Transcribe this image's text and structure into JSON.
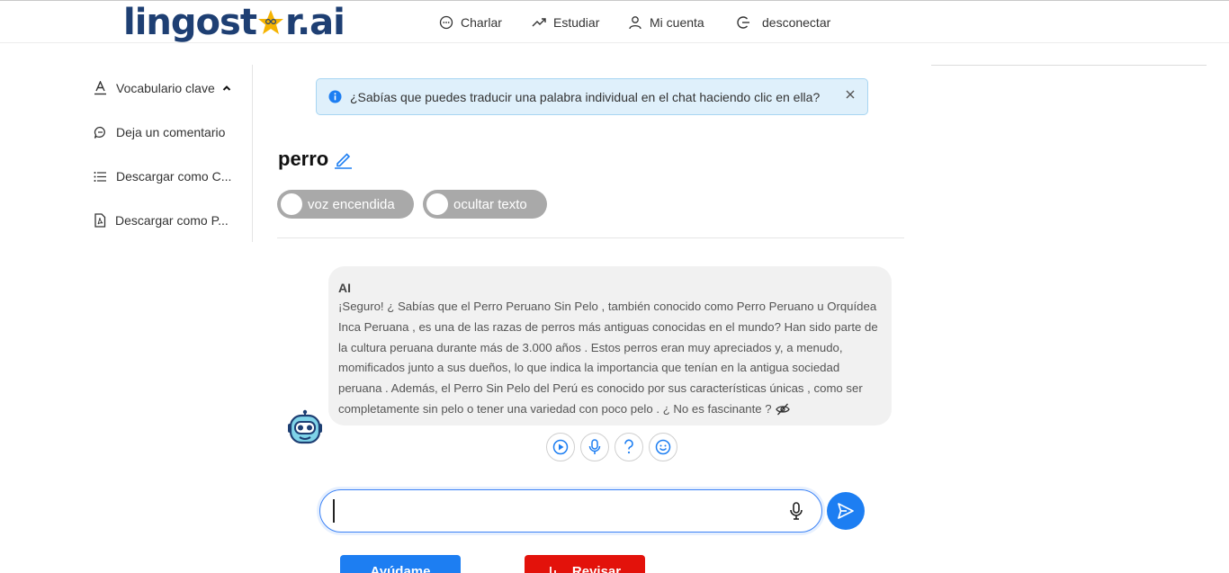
{
  "brand": {
    "logo_prefix": "lingost",
    "logo_suffix": "r.ai",
    "primary_color": "#1e3f73",
    "accent_color": "#f5b301"
  },
  "nav": {
    "chat": "Charlar",
    "study": "Estudiar",
    "account": "Mi cuenta",
    "logout": "desconectar"
  },
  "sidebar": {
    "items": [
      {
        "label": "Vocabulario clave",
        "icon": "font-underline-icon"
      },
      {
        "label": "Deja un comentario",
        "icon": "comment-icon"
      },
      {
        "label": "Descargar como C...",
        "icon": "list-icon"
      },
      {
        "label": "Descargar como P...",
        "icon": "pdf-file-icon"
      }
    ]
  },
  "tip": {
    "text": "¿Sabías que puedes traducir una palabra individual en el chat haciendo clic en ella?"
  },
  "topic": {
    "title": "perro"
  },
  "toggles": {
    "voice": "voz encendida",
    "hide_text": "ocultar texto"
  },
  "chat": {
    "sender": "AI",
    "message": "¡Seguro! ¿ Sabías que el Perro Peruano Sin Pelo , también conocido como Perro Peruano u Orquídea Inca Peruana , es una de las razas de perros más antiguas conocidas en el mundo? Han sido parte de la cultura peruana durante más de 3.000 años . Estos perros eran muy apreciados y, a menudo, momificados junto a sus dueños, lo que indica la importancia que tenían en la antigua sociedad peruana . Además, el Perro Sin Pelo del Perú es conocido por sus características únicas , como ser completamente sin pelo o tener una variedad con poco pelo . ¿ No es fascinante ?"
  },
  "composer": {
    "value": "",
    "placeholder": ""
  },
  "buttons": {
    "help": "Ayúdame",
    "review": "Revisar"
  },
  "colors": {
    "button_blue": "#1d7ef2",
    "button_red": "#e3120b",
    "toggle_off": "#a9a9a9"
  }
}
